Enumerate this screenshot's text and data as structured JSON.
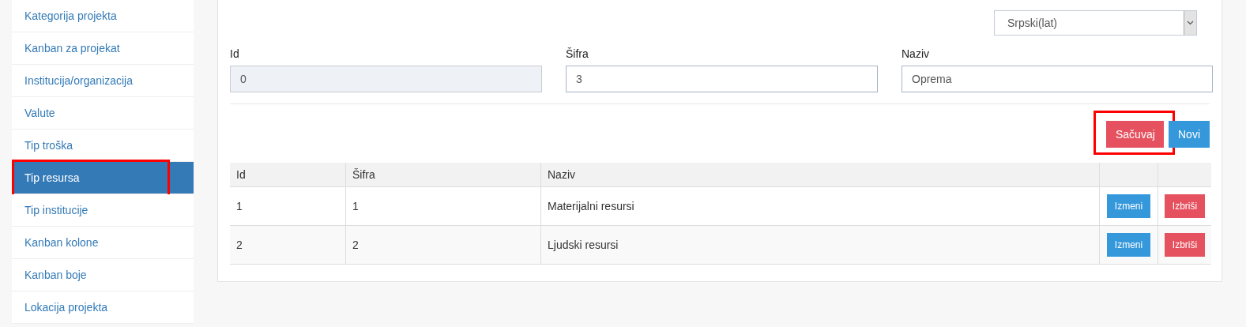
{
  "sidebar": {
    "items": [
      {
        "label": "Kategorija projekta",
        "selected": false,
        "highlighted": false
      },
      {
        "label": "Kanban za projekat",
        "selected": false,
        "highlighted": false
      },
      {
        "label": "Institucija/organizacija",
        "selected": false,
        "highlighted": false
      },
      {
        "label": "Valute",
        "selected": false,
        "highlighted": false
      },
      {
        "label": "Tip troška",
        "selected": false,
        "highlighted": false
      },
      {
        "label": "Tip resursa",
        "selected": true,
        "highlighted": true
      },
      {
        "label": "Tip institucije",
        "selected": false,
        "highlighted": false
      },
      {
        "label": "Kanban kolone",
        "selected": false,
        "highlighted": false
      },
      {
        "label": "Kanban boje",
        "selected": false,
        "highlighted": false
      },
      {
        "label": "Lokacija projekta",
        "selected": false,
        "highlighted": false
      }
    ]
  },
  "language_select": {
    "value": "Srpski(lat)"
  },
  "form": {
    "fields": [
      {
        "label": "Id",
        "value": "0",
        "disabled": true
      },
      {
        "label": "Šifra",
        "value": "3",
        "disabled": false
      },
      {
        "label": "Naziv",
        "value": "Oprema",
        "disabled": false
      }
    ]
  },
  "actions": [
    {
      "label": "Sačuvaj",
      "kind": "danger",
      "highlighted": true
    },
    {
      "label": "Novi",
      "kind": "primary",
      "highlighted": false
    }
  ],
  "table": {
    "columns": [
      "Id",
      "Šifra",
      "Naziv"
    ],
    "rows": [
      {
        "cells": [
          "1",
          "1",
          "Materijalni resursi"
        ],
        "actions": [
          {
            "label": "Izmeni",
            "kind": "primary"
          },
          {
            "label": "Izbriši",
            "kind": "danger"
          }
        ]
      },
      {
        "cells": [
          "2",
          "2",
          "Ljudski resursi"
        ],
        "actions": [
          {
            "label": "Izmeni",
            "kind": "primary"
          },
          {
            "label": "Izbriši",
            "kind": "danger"
          }
        ]
      }
    ]
  }
}
